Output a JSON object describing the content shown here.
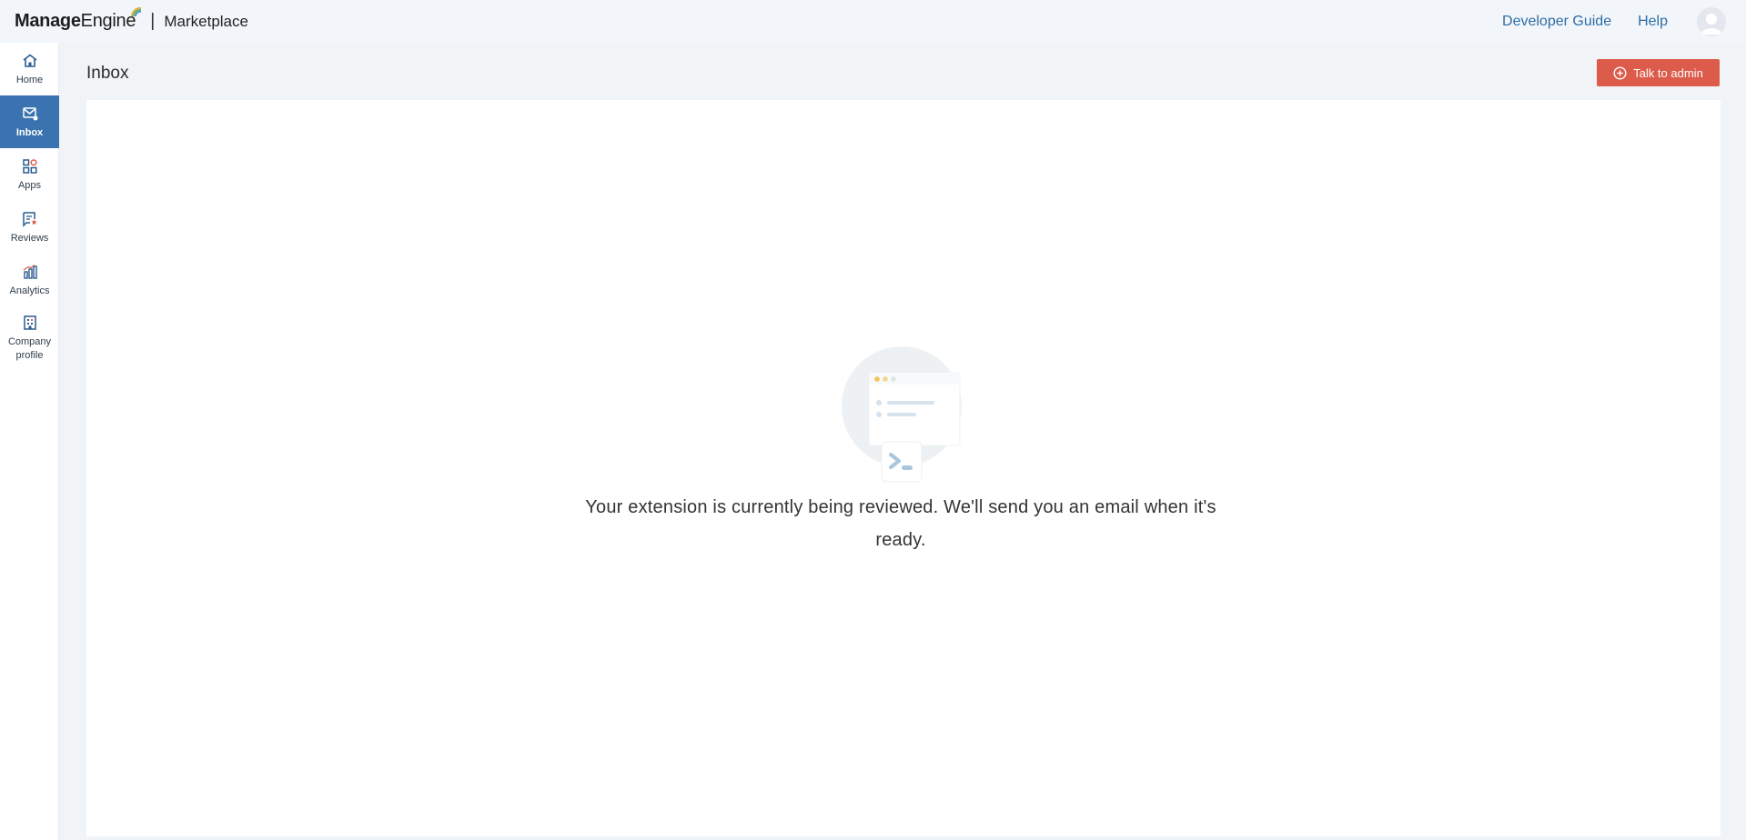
{
  "header": {
    "brand_manage": "Manage",
    "brand_engine": "Engine",
    "brand_separator": "|",
    "product": "Marketplace",
    "links": [
      "Developer Guide",
      "Help"
    ],
    "accent_color": "#2e6da4"
  },
  "sidebar": {
    "active_color": "#3b73b0",
    "items": [
      {
        "label": "Home",
        "icon": "home-icon"
      },
      {
        "label": "Inbox",
        "icon": "inbox-icon"
      },
      {
        "label": "Apps",
        "icon": "apps-icon"
      },
      {
        "label": "Reviews",
        "icon": "reviews-icon"
      },
      {
        "label": "Analytics",
        "icon": "analytics-icon"
      },
      {
        "label": "Company profile",
        "icon": "company-icon"
      }
    ]
  },
  "main": {
    "title": "Inbox",
    "talk_button_label": "Talk to admin",
    "talk_button_color": "#dc5b4a",
    "empty_message": "Your extension is currently being reviewed. We'll send you an email when it's ready."
  }
}
